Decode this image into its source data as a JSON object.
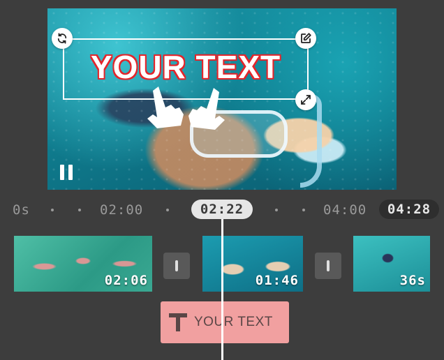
{
  "preview": {
    "overlay_text": "YOUR TEXT",
    "text_color": "#ffffff",
    "text_outline_color": "#e3252b",
    "handles": [
      "rotate-icon",
      "edit-icon",
      "resize-icon"
    ],
    "pointer_icons": [
      "hand-pointer-icon",
      "hand-pointer-icon"
    ],
    "playback_control": "pause-icon"
  },
  "timeline": {
    "ruler": {
      "start": "0s",
      "mark_1": "02:00",
      "mark_2": "04:00",
      "current": "02:22",
      "end": "04:28"
    },
    "clips": [
      {
        "duration": "02:06"
      },
      {
        "duration": "01:46"
      },
      {
        "duration": "36s"
      }
    ],
    "transitions": [
      "transition-icon",
      "transition-icon"
    ],
    "text_track": {
      "icon": "text-icon",
      "label": "YOUR TEXT",
      "color": "#f1a0a0"
    }
  }
}
